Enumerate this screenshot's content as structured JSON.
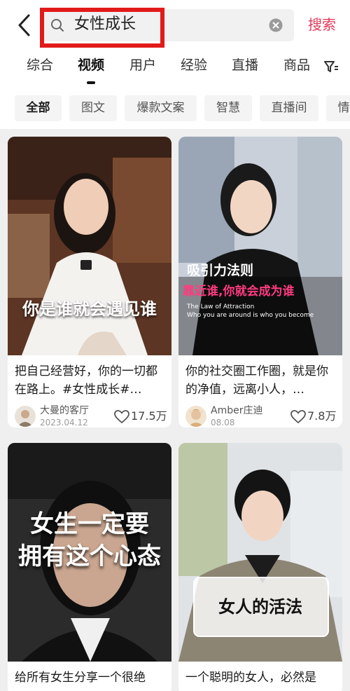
{
  "header": {
    "search_query": "女性成长",
    "search_button": "搜索",
    "icons": {
      "back": "chevron-left-icon",
      "search": "search-icon",
      "clear": "clear-circle-icon"
    },
    "accent_color": "#e3395a",
    "highlight_color": "#e21a1a"
  },
  "tabs": [
    {
      "label": "综合",
      "active": false
    },
    {
      "label": "视频",
      "active": true
    },
    {
      "label": "用户",
      "active": false
    },
    {
      "label": "经验",
      "active": false
    },
    {
      "label": "直播",
      "active": false
    },
    {
      "label": "商品",
      "active": false
    }
  ],
  "filters": [
    "全部",
    "图文",
    "爆款文案",
    "智慧",
    "直播间",
    "情"
  ],
  "feed": {
    "cards": [
      {
        "overlay": "你是谁就会遇见谁",
        "title": "把自己经营好，你的一切都在路上。#女性成长#…",
        "author": "大曼的客厅",
        "date": "2023.04.12",
        "likes": "17.5万"
      },
      {
        "overlay_lines": [
          "吸引力法则",
          "靠近谁,你就会成为谁"
        ],
        "overlay_sub": [
          "The Law of Attraction",
          "Who you are around is who you become"
        ],
        "title": "你的社交圈工作圈，就是你的净值，远离小人，…",
        "author": "Amber庄迪",
        "date": "08.08",
        "likes": "7.8万"
      },
      {
        "overlay_lines": [
          "女生一定要",
          "拥有这个心态"
        ],
        "title": "给所有女生分享一个很绝"
      },
      {
        "overlay": "女人的活法",
        "title": "一个聪明的女人，必然是"
      }
    ]
  }
}
